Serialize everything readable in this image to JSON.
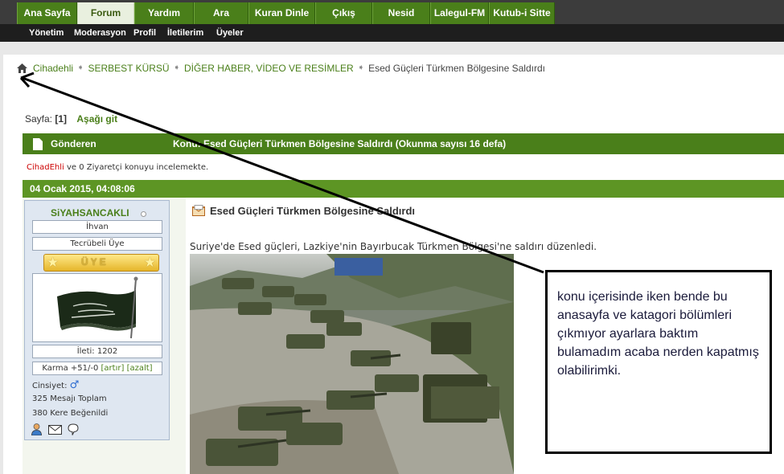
{
  "nav": {
    "tabs": [
      "Ana Sayfa",
      "Forum",
      "Yardım",
      "Ara",
      "Kuran Dinle",
      "Çıkış",
      "Nesid",
      "Lalegul-FM",
      "Kutub-i Sitte"
    ],
    "active_tab": "Forum"
  },
  "subnav": [
    "Yönetim",
    "Moderasyon",
    "Profil",
    "İletilerim",
    "Üyeler"
  ],
  "breadcrumb": [
    "Cihadehli",
    "SERBEST KÜRSÜ",
    "DİĞER HABER, VİDEO VE RESİMLER",
    "Esed Güçleri Türkmen Bölgesine Saldırdı"
  ],
  "pagination": {
    "label": "Sayfa:",
    "current": "[1]",
    "down_link": "Aşağı git"
  },
  "thread_header": {
    "sender_col": "Gönderen",
    "title": "Konu: Esed Güçleri Türkmen Bölgesine Saldırdı  (Okunma sayısı 16 defa)"
  },
  "viewers": {
    "user": "CihadEhli",
    "rest": " ve 0 Ziyaretçi konuyu incelemekte."
  },
  "post": {
    "date": "04 Ocak 2015, 04:08:06",
    "title": "Esed Güçleri Türkmen Bölgesine Saldırdı",
    "text": "Suriye'de Esed güçleri, Lazkiye'nin Bayırbucak Türkmen Bölgesi'ne saldırı düzenledi.",
    "image": "tank-column-photo"
  },
  "user": {
    "name": "SiYAHSANCAKLI",
    "group": "İhvan",
    "rank": "Tecrübeli Üye",
    "rank_image_text": "ÜYE",
    "posts": "İleti: 1202",
    "karma": "Karma +51/-0",
    "karma_up": "[artır]",
    "karma_down": "[azalt]",
    "gender_label": "Cinsiyet:",
    "gender_symbol": "♂",
    "total_posts": "325 Mesajı Toplam",
    "likes": "380 Kere Beğenildi",
    "avatar": "black-flag-avatar",
    "icons": [
      "profile-icon",
      "email-icon",
      "message-icon"
    ]
  },
  "annotation": "konu içerisinde iken bende bu anasayfa ve katagori bölümleri çıkmıyor ayarlara baktım bulamadım acaba nerden kapatmış olabilirimki.",
  "colors": {
    "nav_green": "#4a7f1a",
    "header_green": "#5d9524",
    "link_green": "#4a7f1a",
    "annotation_border": "#000000"
  }
}
